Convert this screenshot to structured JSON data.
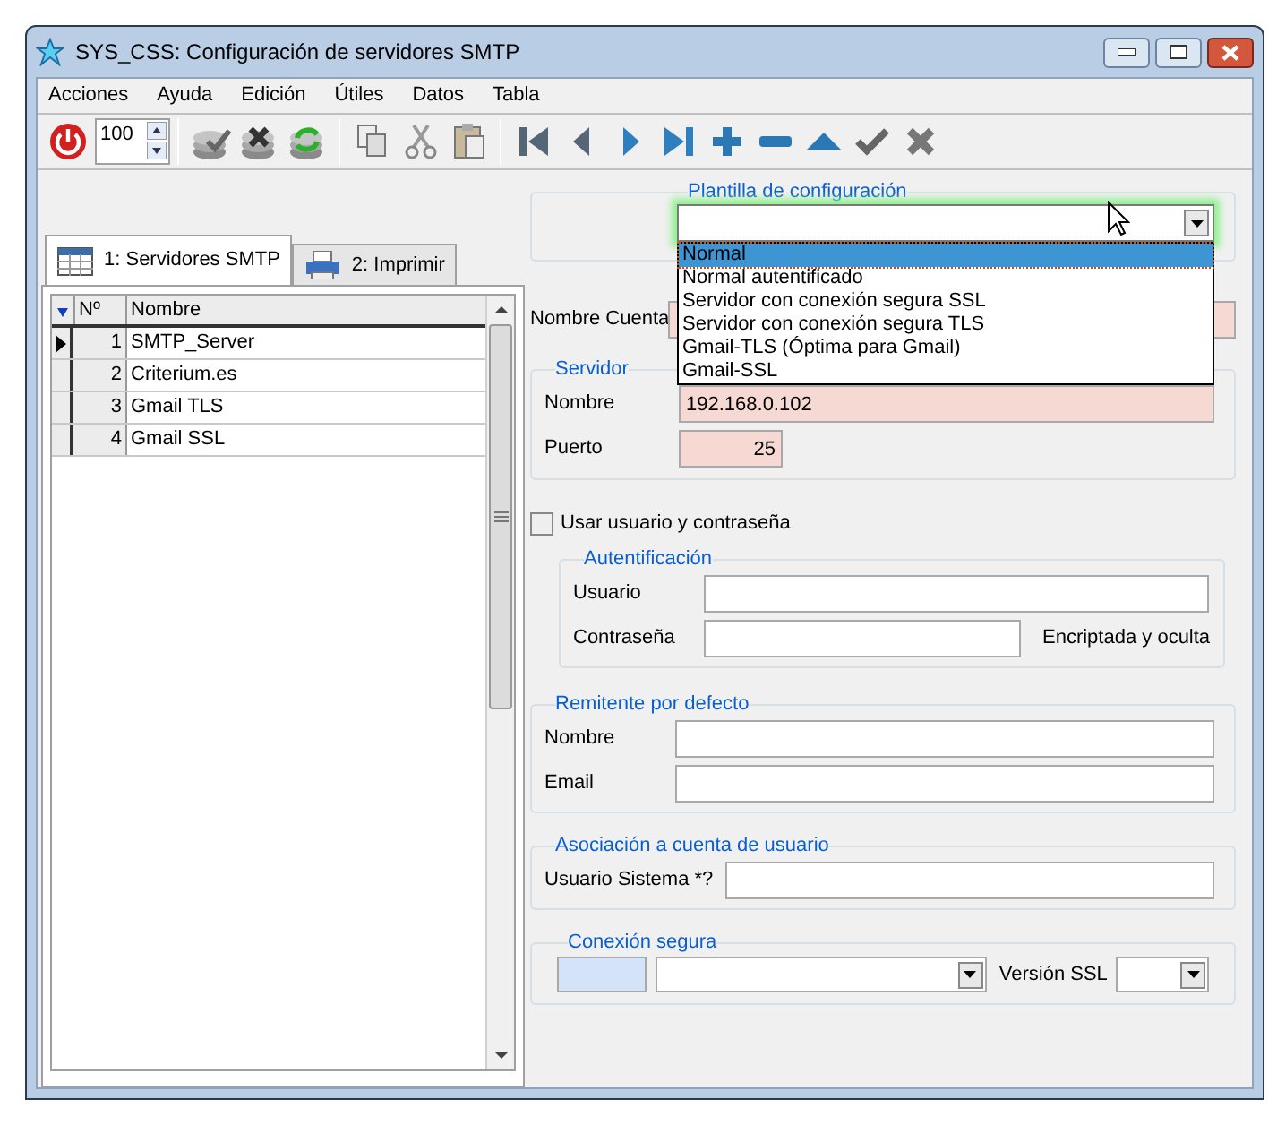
{
  "window": {
    "title": "SYS_CSS: Configuración de servidores SMTP"
  },
  "menu": [
    "Acciones",
    "Ayuda",
    "Edición",
    "Útiles",
    "Datos",
    "Tabla"
  ],
  "toolbar": {
    "spin_value": "100"
  },
  "tabs": [
    {
      "label": "1: Servidores SMTP",
      "selected": true
    },
    {
      "label": "2: Imprimir",
      "selected": false
    }
  ],
  "grid": {
    "columns": [
      "Nº",
      "Nombre"
    ],
    "rows": [
      {
        "number": "1",
        "name": "SMTP_Server",
        "selected": true
      },
      {
        "number": "2",
        "name": "Criterium.es",
        "selected": false
      },
      {
        "number": "3",
        "name": "Gmail TLS",
        "selected": false
      },
      {
        "number": "4",
        "name": "Gmail SSL",
        "selected": false
      }
    ]
  },
  "template": {
    "title": "Plantilla de configuración",
    "options": [
      {
        "label": "Normal",
        "selected": true
      },
      {
        "label": "Normal autentificado",
        "selected": false
      },
      {
        "label": "Servidor con conexión segura SSL",
        "selected": false
      },
      {
        "label": "Servidor con conexión segura TLS",
        "selected": false
      },
      {
        "label": "Gmail-TLS (Óptima para Gmail)",
        "selected": false
      },
      {
        "label": "Gmail-SSL",
        "selected": false
      }
    ]
  },
  "account": {
    "label": "Nombre Cuenta",
    "required": true
  },
  "server": {
    "title": "Servidor",
    "fields": [
      {
        "label": "Nombre",
        "value": "192.168.0.102",
        "required": true
      },
      {
        "label": "Puerto",
        "value": "25",
        "required": true
      }
    ]
  },
  "use_credentials": {
    "label": "Usar usuario y contraseña",
    "checked": false
  },
  "auth": {
    "title": "Autentificación",
    "fields": [
      {
        "label": "Usuario",
        "required": false
      },
      {
        "label": "Contraseña",
        "required": false,
        "note": "Encriptada y oculta"
      }
    ]
  },
  "sender": {
    "title": "Remitente por defecto",
    "fields": [
      {
        "label": "Nombre",
        "required": false
      },
      {
        "label": "Email",
        "required": false
      }
    ]
  },
  "association": {
    "title": "Asociación a cuenta de usuario",
    "fields": [
      {
        "label": "Usuario Sistema *?",
        "required": false
      }
    ]
  },
  "secure": {
    "title": "Conexión segura",
    "ssl_version_label": "Versión SSL"
  }
}
